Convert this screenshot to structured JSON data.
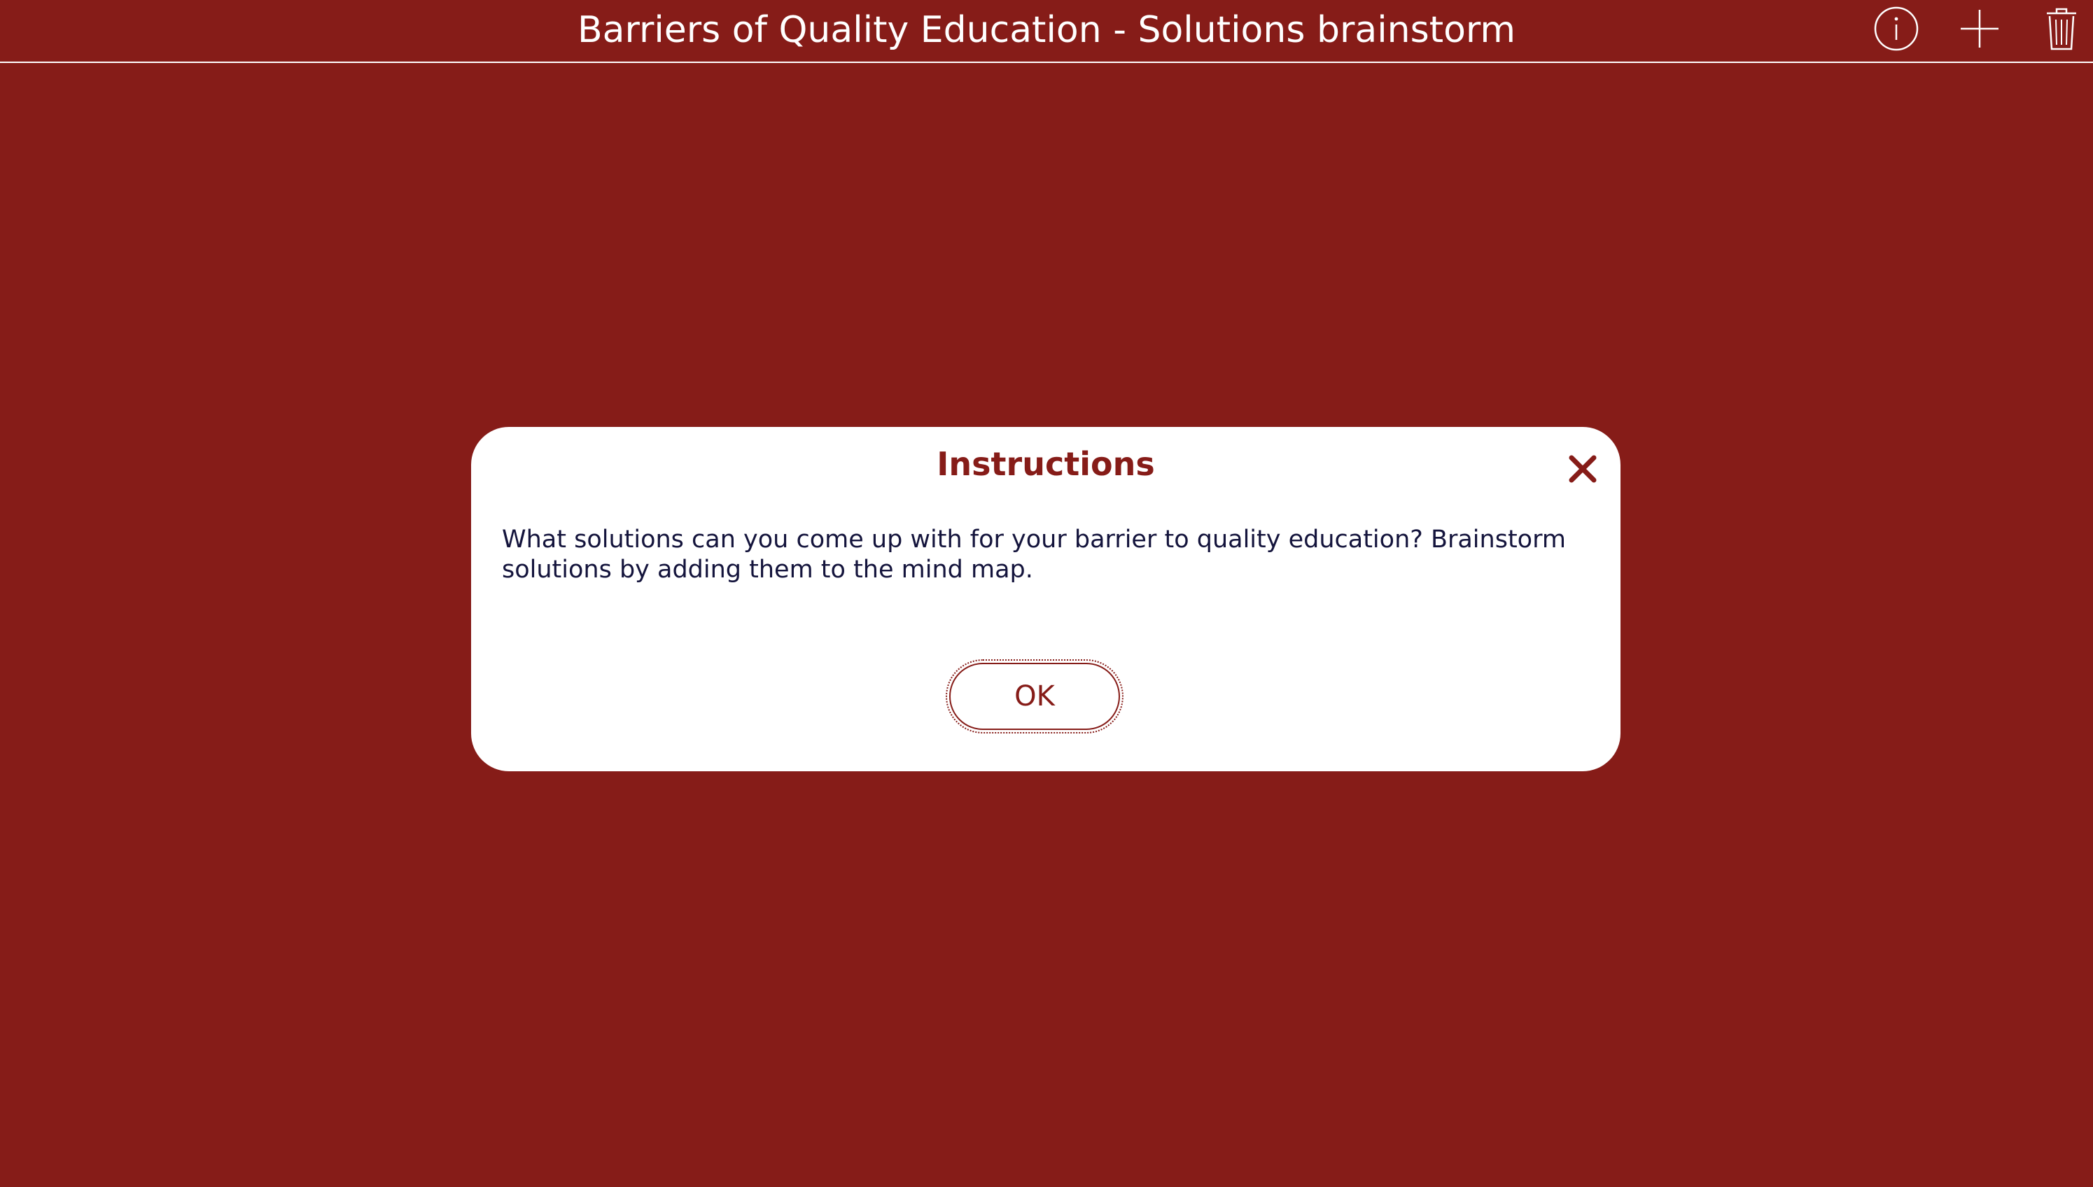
{
  "header": {
    "title": "Barriers of Quality Education - Solutions brainstorm",
    "icons": {
      "info": "info-icon",
      "add": "plus-icon",
      "delete": "trash-icon"
    }
  },
  "modal": {
    "title": "Instructions",
    "body": "What solutions can you come up with for your barrier to quality education? Brainstorm solutions by adding them to the mind map.",
    "ok_label": "OK",
    "close_icon": "close-icon"
  },
  "colors": {
    "background": "#861c18",
    "accent": "#861c18",
    "dialog": "#ffffff",
    "body_text": "#14143c"
  }
}
